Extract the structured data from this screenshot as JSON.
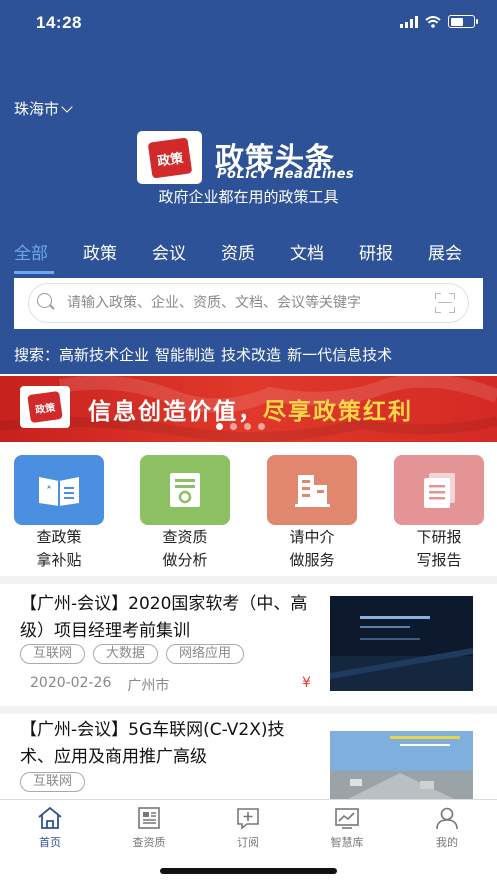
{
  "status_bar": {
    "time": "14:28"
  },
  "header": {
    "city": "珠海市",
    "brand_cn": "政策头条",
    "brand_en": "PoLicY HeadLines",
    "logo_text": "政策",
    "slogan": "政府企业都在用的政策工具",
    "colors": {
      "background": "#2d5297",
      "active_tab": "#6fa6f0"
    }
  },
  "tabs": [
    {
      "label": "全部",
      "active": true
    },
    {
      "label": "政策"
    },
    {
      "label": "会议"
    },
    {
      "label": "资质"
    },
    {
      "label": "文档"
    },
    {
      "label": "研报"
    },
    {
      "label": "展会"
    }
  ],
  "search": {
    "placeholder": "请输入政策、企业、资质、文档、会议等关键字",
    "value": ""
  },
  "hot_search": {
    "label": "搜索：",
    "keywords": [
      "高新技术企业",
      "智能制造",
      "技术改造",
      "新一代信息技术"
    ]
  },
  "banner": {
    "logo_text": "政策",
    "text_part1": "信息创造价值，",
    "text_part2": "尽享政策红利",
    "slide_count": 4,
    "active_slide": 0
  },
  "quick_actions": [
    {
      "icon": "book-icon",
      "line1": "查政策",
      "line2": "拿补贴",
      "color": "#4a8fe0"
    },
    {
      "icon": "certificate-icon",
      "line1": "查资质",
      "line2": "做分析",
      "color": "#8dbf63"
    },
    {
      "icon": "building-icon",
      "line1": "请中介",
      "line2": "做服务",
      "color": "#e0876d"
    },
    {
      "icon": "document-icon",
      "line1": "下研报",
      "line2": "写报告",
      "color": "#e49494"
    }
  ],
  "news": [
    {
      "title": "【广州-会议】2020国家软考（中、高级）项目经理考前集训",
      "tags": [
        "互联网",
        "大数据",
        "网络应用"
      ],
      "date": "2020-02-26",
      "location": "广州市",
      "price_symbol": "¥"
    },
    {
      "title": "【广州-会议】5G车联网(C-V2X)技术、应用及商用推广高级",
      "tags": [
        "互联网"
      ]
    }
  ],
  "tabbar": [
    {
      "icon": "home-icon",
      "label": "首页",
      "active": true
    },
    {
      "icon": "newspaper-icon",
      "label": "查资质"
    },
    {
      "icon": "subscribe-icon",
      "label": "订阅"
    },
    {
      "icon": "chart-icon",
      "label": "智慧库"
    },
    {
      "icon": "user-icon",
      "label": "我的"
    }
  ]
}
